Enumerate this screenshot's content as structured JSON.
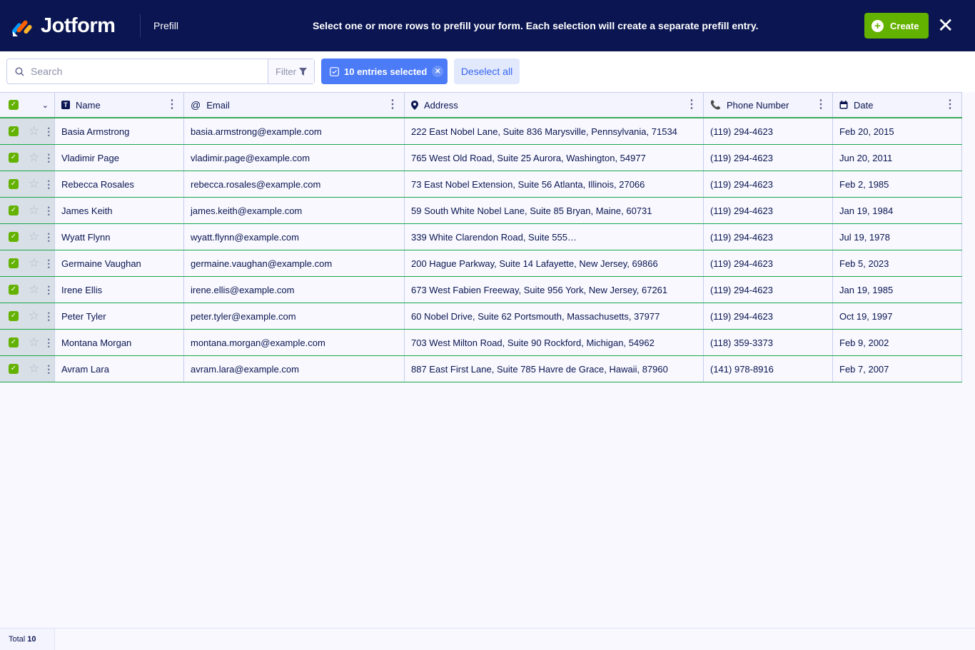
{
  "header": {
    "brand": "Jotform",
    "section": "Prefill",
    "message": "Select one or more rows to prefill your form. Each selection will create a separate prefill entry.",
    "create_label": "Create",
    "colors": {
      "background": "#0a1551",
      "create": "#64b200"
    }
  },
  "toolbar": {
    "search_placeholder": "Search",
    "filter_label": "Filter",
    "selected_label": "10 entries selected",
    "deselect_label": "Deselect all"
  },
  "columns": [
    {
      "label": "Name",
      "icon": "text-field-icon"
    },
    {
      "label": "Email",
      "icon": "at-icon"
    },
    {
      "label": "Address",
      "icon": "location-pin-icon"
    },
    {
      "label": "Phone Number",
      "icon": "phone-icon"
    },
    {
      "label": "Date",
      "icon": "calendar-icon"
    }
  ],
  "rows": [
    [
      "Basia Armstrong",
      "basia.armstrong@example.com",
      "222 East Nobel Lane, Suite 836  Marysville, Pennsylvania, 71534",
      "(119) 294-4623",
      "Feb 20, 2015"
    ],
    [
      "Vladimir Page",
      "vladimir.page@example.com",
      "765 West Old Road, Suite 25  Aurora, Washington, 54977",
      "(119) 294-4623",
      "Jun 20, 2011"
    ],
    [
      "Rebecca Rosales",
      "rebecca.rosales@example.com",
      "73 East Nobel Extension, Suite 56  Atlanta, Illinois, 27066",
      "(119) 294-4623",
      "Feb 2, 1985"
    ],
    [
      "James Keith",
      "james.keith@example.com",
      "59 South White Nobel Lane, Suite 85  Bryan, Maine, 60731",
      "(119) 294-4623",
      "Jan 19, 1984"
    ],
    [
      "Wyatt Flynn",
      "wyatt.flynn@example.com",
      "339 White Clarendon Road, Suite 555…",
      "(119) 294-4623",
      "Jul 19, 1978"
    ],
    [
      "Germaine Vaughan",
      "germaine.vaughan@example.com",
      "200 Hague Parkway, Suite 14  Lafayette, New Jersey, 69866",
      "(119) 294-4623",
      "Feb 5, 2023"
    ],
    [
      "Irene Ellis",
      "irene.ellis@example.com",
      "673 West Fabien Freeway, Suite 956  York, New Jersey, 67261",
      "(119) 294-4623",
      "Jan 19, 1985"
    ],
    [
      "Peter Tyler",
      "peter.tyler@example.com",
      "60 Nobel Drive, Suite 62  Portsmouth, Massachusetts, 37977",
      "(119) 294-4623",
      "Oct 19, 1997"
    ],
    [
      "Montana Morgan",
      "montana.morgan@example.com",
      "703 West Milton Road, Suite 90  Rockford, Michigan, 54962",
      "(118) 359-3373",
      "Feb 9, 2002"
    ],
    [
      "Avram Lara",
      "avram.lara@example.com",
      "887 East First Lane, Suite 785  Havre de Grace, Hawaii, 87960",
      "(141) 978-8916",
      "Feb 7, 2007"
    ]
  ],
  "footer": {
    "total_label": "Total",
    "total_count": "10"
  }
}
